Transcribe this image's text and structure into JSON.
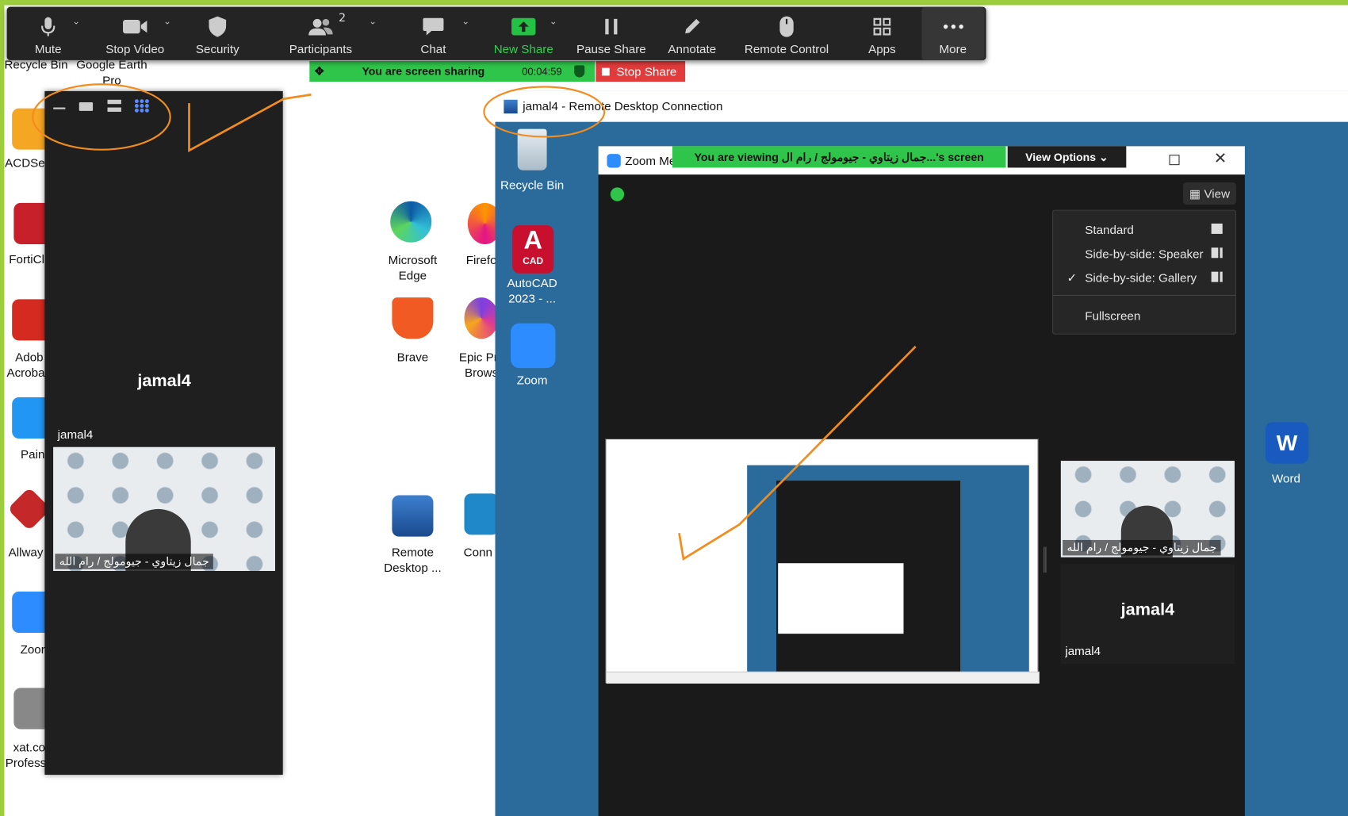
{
  "toolbar": {
    "mute": "Mute",
    "stop_video": "Stop Video",
    "security": "Security",
    "participants": "Participants",
    "participants_count": "2",
    "chat": "Chat",
    "new_share": "New Share",
    "pause_share": "Pause Share",
    "annotate": "Annotate",
    "remote_control": "Remote Control",
    "apps": "Apps",
    "more": "More"
  },
  "sharebar": {
    "status": "You are screen sharing",
    "timer": "00:04:59",
    "stop_label": "Stop Share"
  },
  "desktop_left": {
    "recycle_bin": "Recycle Bin",
    "google_earth": "Google Earth",
    "google_earth2": "Pro",
    "acdsee": "ACDSe",
    "forticlient": "FortiCl",
    "adobe1": "Adob",
    "adobe2": "Acroba",
    "paint": "Pain",
    "allway": "Allway",
    "zoom": "Zoor",
    "xat1": "xat.co",
    "xat2": "Profess"
  },
  "desktop_mid": {
    "edge1": "Microsoft",
    "edge2": "Edge",
    "firefox": "Firefo",
    "brave": "Brave",
    "epic1": "Epic Pri",
    "epic2": "Brows",
    "remote1": "Remote",
    "remote2": "Desktop ...",
    "connect": "Conn"
  },
  "panel": {
    "participant_big": "jamal4",
    "participant_tag": "jamal4",
    "video_name": "جمال زيتاوي - جيومولج / رام الله"
  },
  "rdc": {
    "title": "jamal4 - Remote Desktop Connection",
    "recycle_bin": "Recycle Bin",
    "autocad1": "AutoCAD",
    "autocad2": "2023 - ...",
    "autocad_badge": "CAD",
    "zoom": "Zoom",
    "word": "Word"
  },
  "zoomwin": {
    "title": "Zoom Me",
    "viewing_banner": "You are viewing جمال زيتاوي - جيومولج / رام ال...'s screen",
    "view_options": "View Options",
    "view_button": "View",
    "menu": {
      "standard": "Standard",
      "sbs_speaker": "Side-by-side: Speaker",
      "sbs_gallery": "Side-by-side: Gallery",
      "fullscreen": "Fullscreen",
      "checked": "✓"
    },
    "video_name": "جمال زيتاوي - جيومولج / رام الله",
    "participant_big": "jamal4",
    "participant_tag": "jamal4"
  }
}
